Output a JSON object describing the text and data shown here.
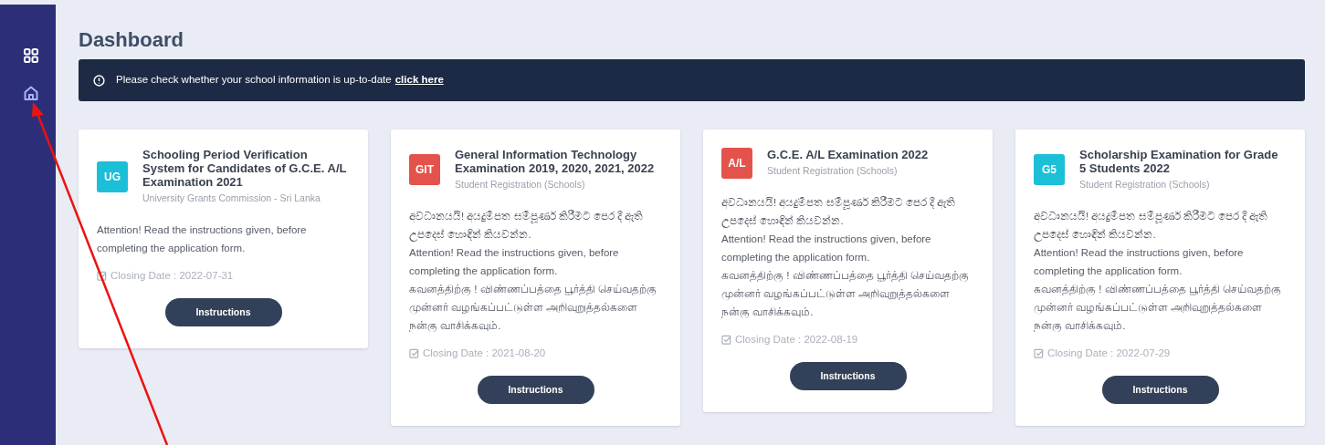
{
  "sidebar": {
    "items": [
      {
        "kind": "grid",
        "selected": false
      },
      {
        "kind": "home",
        "selected": true
      }
    ]
  },
  "page_title": "Dashboard",
  "notice": {
    "text": "Please check whether your school information is up-to-date",
    "link": "click here"
  },
  "cards": [
    {
      "badge": "UG",
      "color": "#1bbfd8",
      "title": "Schooling Period Verification System for Candidates of G.C.E. A/L Examination 2021",
      "subtitle": "University Grants Commission - Sri Lanka",
      "paragraphs": [
        "Attention! Read the instructions given, before completing the application form."
      ],
      "closing": "Closing Date : 2022-07-31",
      "button": "Instructions"
    },
    {
      "badge": "GIT",
      "color": "#e4534b",
      "title": "General Information Technology Examination 2019, 2020, 2021, 2022",
      "subtitle": "Student Registration (Schools)",
      "paragraphs": [
        "අවධානයයි! අයදුම්පත සම්පූර්ණ කිරීමට පෙර දී ඇති උපදෙස් හොඳින් කියවන්න.",
        "Attention! Read the instructions given, before completing the application form.",
        "கவனத்திற்கு ! விண்ணப்பத்தை பூர்த்தி செய்வதற்கு முன்னர் வழங்கப்பட்டுள்ள அறிவுறுத்தல்களை நன்கு வாசிக்கவும்."
      ],
      "closing": "Closing Date : 2021-08-20",
      "button": "Instructions"
    },
    {
      "badge": "A/L",
      "color": "#e4534b",
      "title": "G.C.E. A/L Examination 2022",
      "subtitle": "Student Registration (Schools)",
      "paragraphs": [
        "අවධානයයි! අයදුම්පත සම්පූර්ණ කිරීමට පෙර දී ඇති උපදෙස් හොඳින් කියවන්න.",
        "Attention! Read the instructions given, before completing the application form.",
        "கவனத்திற்கு ! விண்ணப்பத்தை பூர்த்தி செய்வதற்கு முன்னர் வழங்கப்பட்டுள்ள அறிவுறுத்தல்களை நன்கு வாசிக்கவும்."
      ],
      "closing": "Closing Date : 2022-08-19",
      "button": "Instructions"
    },
    {
      "badge": "G5",
      "color": "#1bbfd8",
      "title": "Scholarship Examination for Grade 5 Students 2022",
      "subtitle": "Student Registration (Schools)",
      "paragraphs": [
        "අවධානයයි! අයදුම්පත සම්පූර්ණ කිරීමට පෙර දී ඇති උපදෙස් හොඳින් කියවන්න.",
        "Attention! Read the instructions given, before completing the application form.",
        "கவனத்திற்கு ! விண்ணப்பத்தை பூர்த்தி செய்வதற்கு முன்னர் வழங்கப்பட்டுள்ள அறிவுறுத்தல்களை நன்கு வாசிக்கவும்."
      ],
      "closing": "Closing Date : 2022-07-29",
      "button": "Instructions"
    }
  ]
}
